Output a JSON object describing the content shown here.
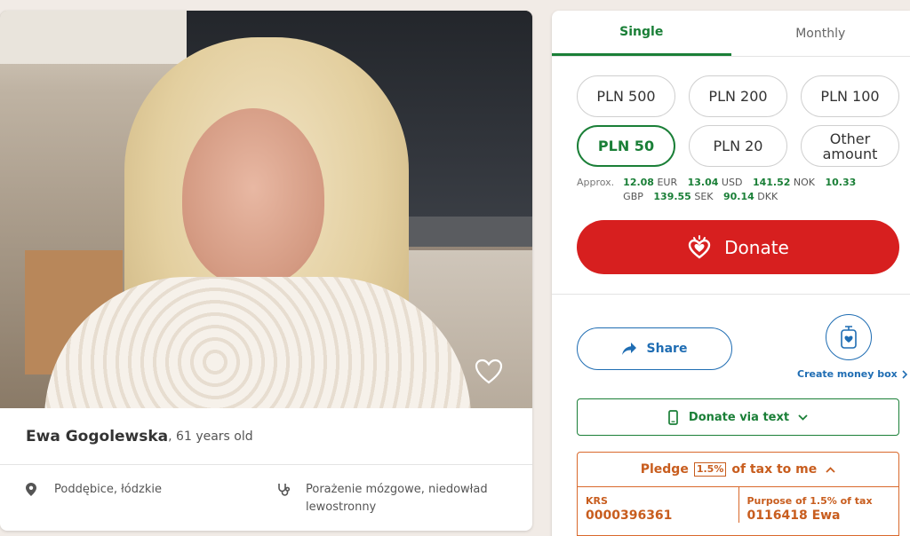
{
  "profile": {
    "name": "Ewa Gogolewska",
    "age_text": ", 61 years old",
    "location": "Poddębice, łódzkie",
    "diagnosis": "Porażenie mózgowe, niedowład lewostronny"
  },
  "donate": {
    "tabs": [
      {
        "label": "Single",
        "active": true
      },
      {
        "label": "Monthly",
        "active": false
      }
    ],
    "amounts": [
      {
        "label": "PLN 500",
        "selected": false
      },
      {
        "label": "PLN 200",
        "selected": false
      },
      {
        "label": "PLN 100",
        "selected": false
      },
      {
        "label": "PLN 50",
        "selected": true
      },
      {
        "label": "PLN 20",
        "selected": false
      },
      {
        "label": "Other\namount",
        "selected": false
      }
    ],
    "approx_label": "Approx.",
    "approx": [
      {
        "value": "12.08",
        "currency": "EUR"
      },
      {
        "value": "13.04",
        "currency": "USD"
      },
      {
        "value": "141.52",
        "currency": "NOK"
      },
      {
        "value": "10.33",
        "currency": "GBP"
      },
      {
        "value": "139.55",
        "currency": "SEK"
      },
      {
        "value": "90.14",
        "currency": "DKK"
      }
    ],
    "donate_label": "Donate",
    "share_label": "Share",
    "moneybox_label": "Create money box",
    "text_label": "Donate via text",
    "tax": {
      "pledge_prefix": "Pledge",
      "pledge_pct": "1.5%",
      "pledge_suffix": "of tax to me",
      "krs_label": "KRS",
      "krs_value": "0000396361",
      "purpose_label": "Purpose of 1.5% of tax",
      "purpose_value": "0116418 Ewa"
    }
  },
  "colors": {
    "green": "#1a7f37",
    "red": "#d71f1f",
    "blue": "#1f6db3",
    "orange": "#c85d1e"
  },
  "icons": [
    "heart-icon",
    "location-pin-icon",
    "stethoscope-icon",
    "donate-heart-hand-icon",
    "share-arrow-icon",
    "money-box-icon",
    "chevron-right-icon",
    "phone-icon",
    "chevron-down-icon",
    "chevron-up-icon"
  ]
}
